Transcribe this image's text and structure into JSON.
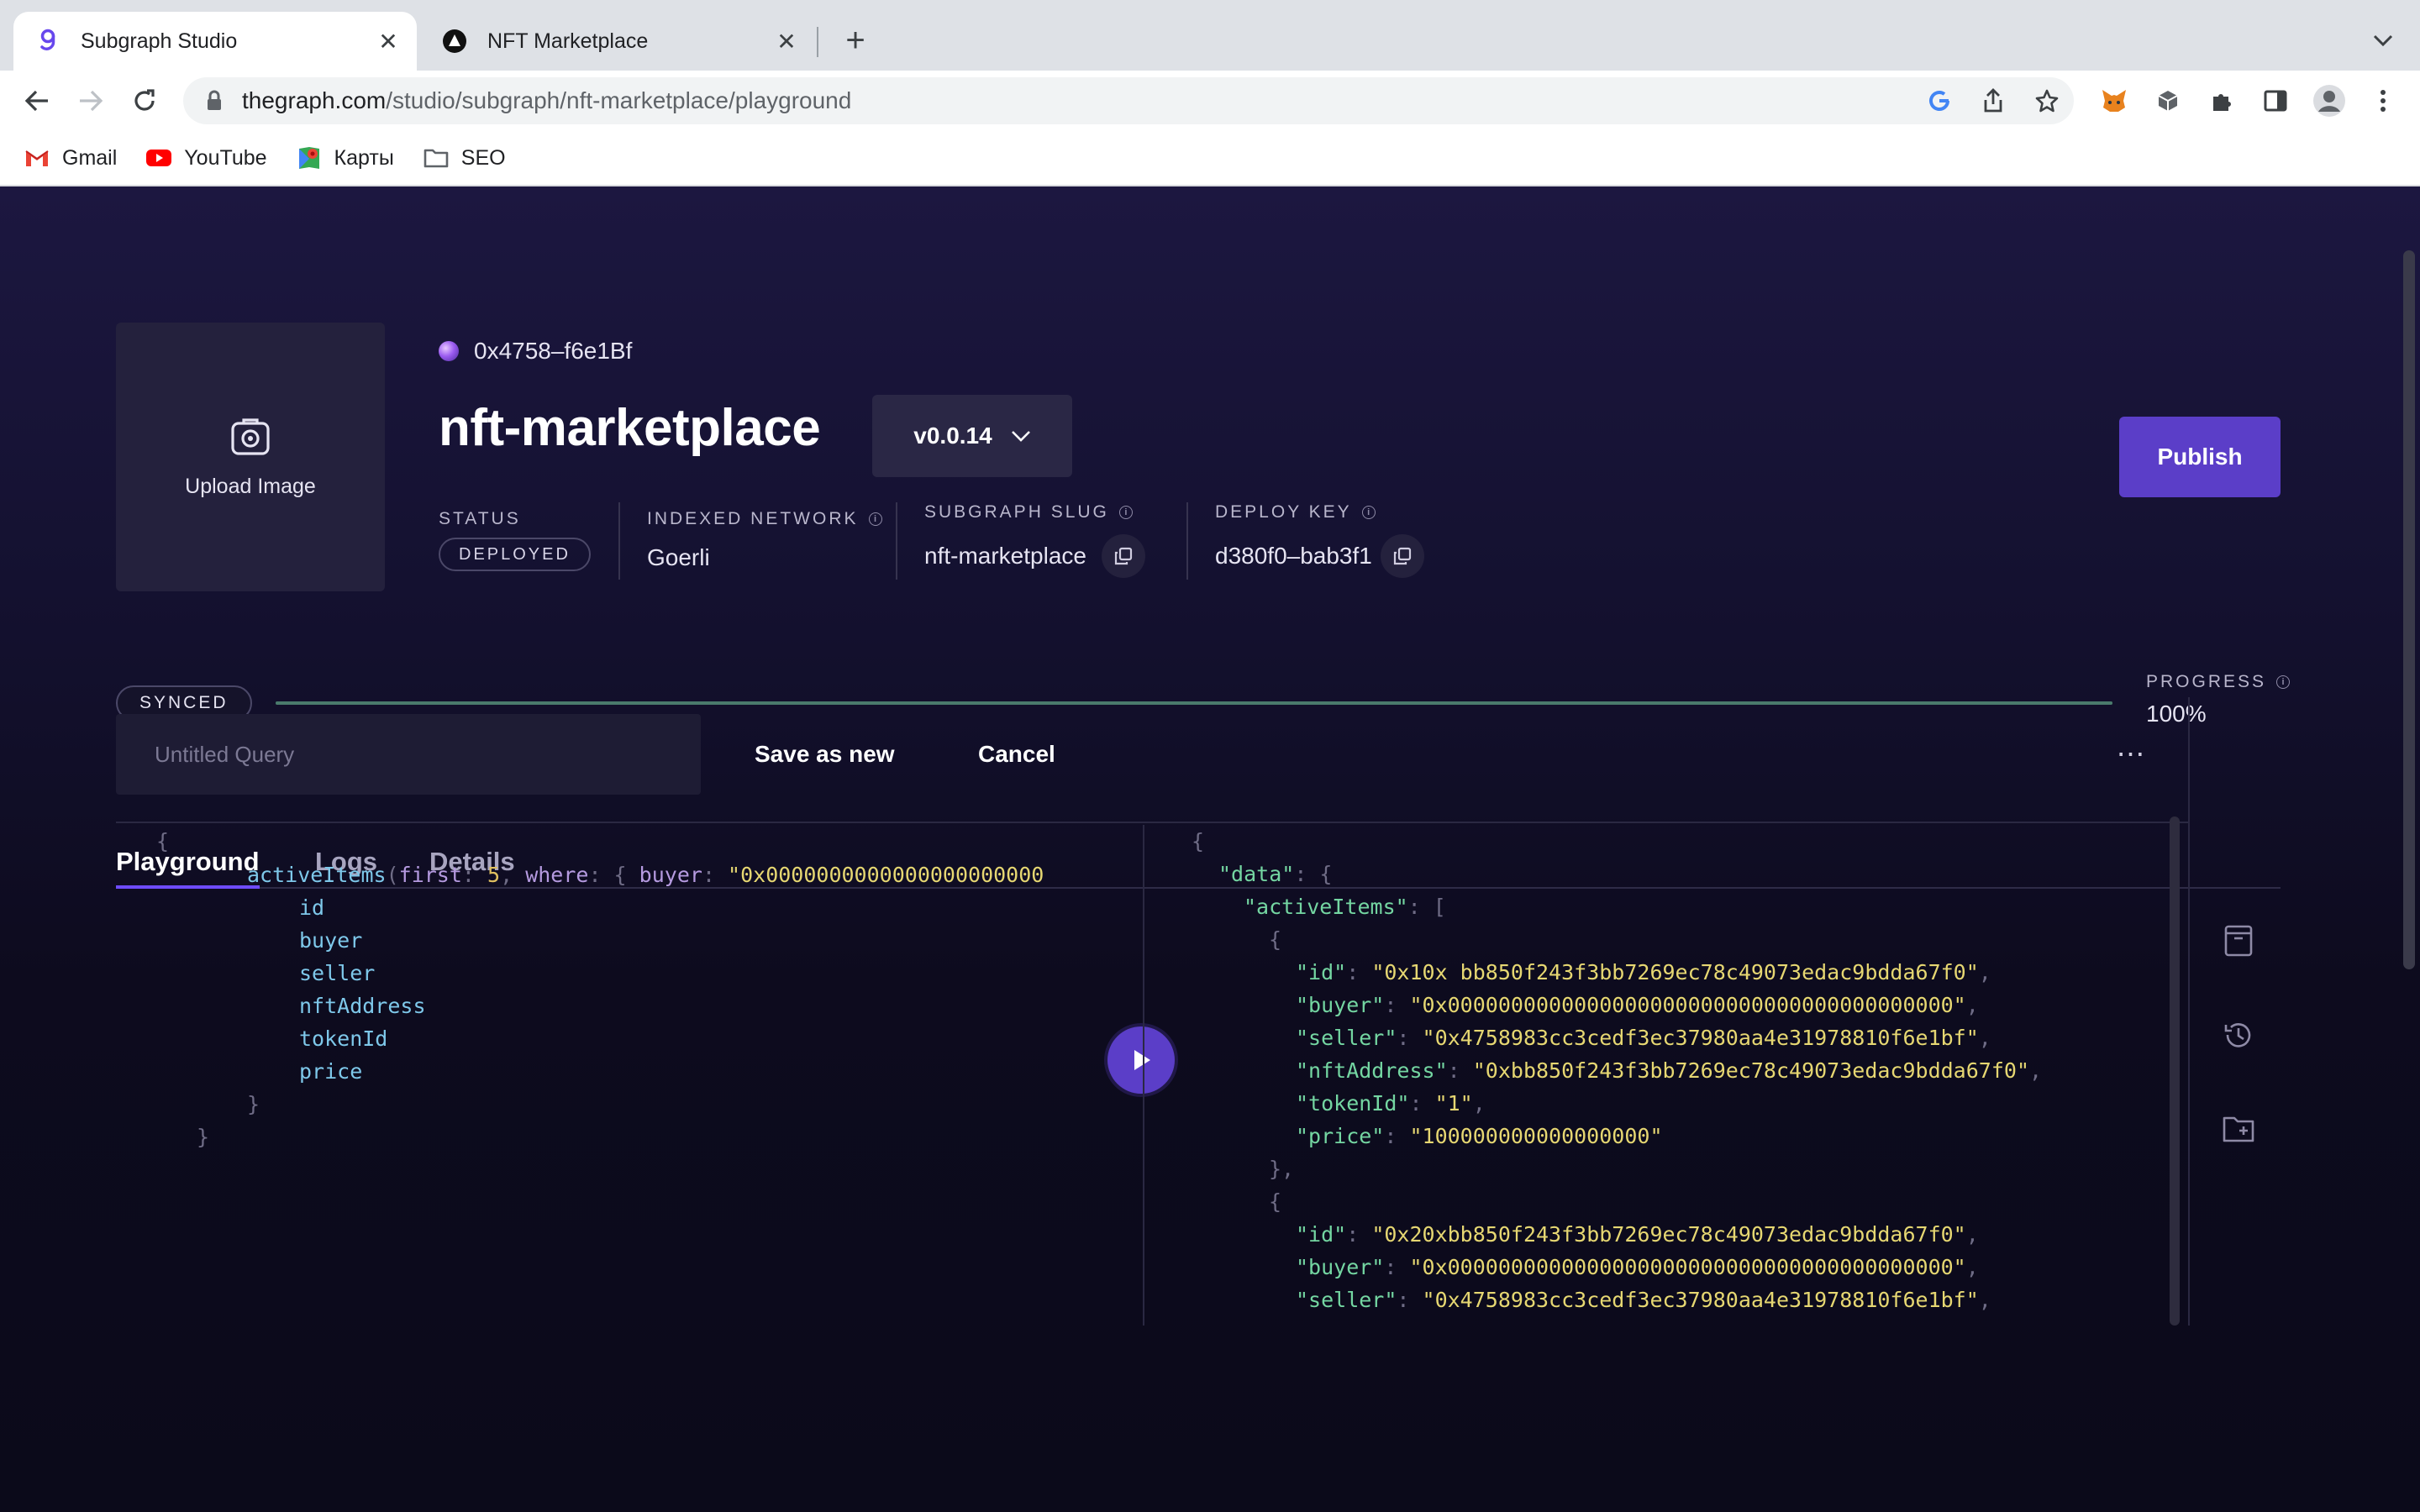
{
  "browser": {
    "tabs": [
      {
        "title": "Subgraph Studio",
        "active": true
      },
      {
        "title": "NFT Marketplace",
        "active": false
      }
    ],
    "url": {
      "host": "thegraph.com",
      "path": "/studio/subgraph/nft-marketplace/playground"
    },
    "bookmarks": [
      {
        "label": "Gmail",
        "icon": "gmail-icon"
      },
      {
        "label": "YouTube",
        "icon": "youtube-icon"
      },
      {
        "label": "Карты",
        "icon": "maps-icon"
      },
      {
        "label": "SEO",
        "icon": "folder-icon"
      }
    ]
  },
  "subgraph": {
    "upload_label": "Upload Image",
    "owner": "0x4758–f6e1Bf",
    "name": "nft-marketplace",
    "version": "v0.0.14",
    "publish_label": "Publish",
    "status": {
      "label": "STATUS",
      "value": "DEPLOYED"
    },
    "network": {
      "label": "INDEXED NETWORK",
      "value": "Goerli"
    },
    "slug": {
      "label": "SUBGRAPH SLUG",
      "value": "nft-marketplace"
    },
    "deploy_key": {
      "label": "DEPLOY KEY",
      "value": "d380f0–bab3f1"
    },
    "sync_state": "SYNCED",
    "progress": {
      "label": "PROGRESS",
      "value": "100%",
      "fraction": 1.0
    }
  },
  "tabs": [
    {
      "label": "Playground",
      "active": true
    },
    {
      "label": "Logs",
      "active": false
    },
    {
      "label": "Details",
      "active": false
    }
  ],
  "playground": {
    "query_name_placeholder": "Untitled Query",
    "save_label": "Save as new",
    "cancel_label": "Cancel",
    "more_label": "⋯",
    "query": {
      "open": "{",
      "entity": "activeItems",
      "args_prefix": "(",
      "arg1_name": "first",
      "arg1_value": "5",
      "arg2_name": "where",
      "filter_field": "buyer",
      "filter_value": "\"0x0000000000000000000000",
      "fields": [
        "id",
        "buyer",
        "seller",
        "nftAddress",
        "tokenId",
        "price"
      ],
      "close_inner": "}",
      "close_outer": "}"
    },
    "result": {
      "root_key": "\"data\"",
      "entity_key": "\"activeItems\"",
      "items": [
        {
          "id": "\"0x10x bb850f243f3bb7269ec78c49073edac9bdda67f0\"",
          "buyer": "\"0x0000000000000000000000000000000000000000\"",
          "seller": "\"0x4758983cc3cedf3ec37980aa4e31978810f6e1bf\"",
          "nftAddress": "\"0xbb850f243f3bb7269ec78c49073edac9bdda67f0\"",
          "tokenId": "\"1\"",
          "price": "\"100000000000000000\""
        },
        {
          "id": "\"0x20xbb850f243f3bb7269ec78c49073edac9bdda67f0\"",
          "buyer": "\"0x0000000000000000000000000000000000000000\"",
          "seller": "\"0x4758983cc3cedf3ec37980aa4e31978810f6e1bf\""
        }
      ]
    }
  }
}
